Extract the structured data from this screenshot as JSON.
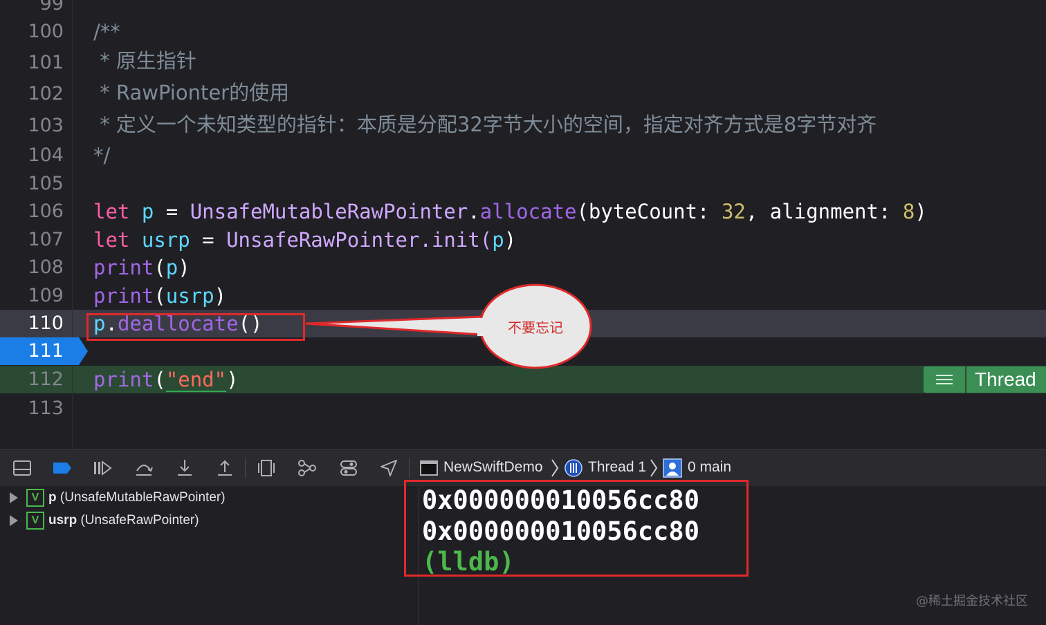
{
  "editor": {
    "lines": [
      {
        "num": "99"
      },
      {
        "num": "100",
        "text": "/**"
      },
      {
        "num": "101",
        "text": " * 原生指针"
      },
      {
        "num": "102",
        "text": " * RawPionter的使用"
      },
      {
        "num": "103",
        "text": " * 定义一个未知类型的指针：本质是分配32字节大小的空间，指定对齐方式是8字节对齐"
      },
      {
        "num": "104",
        "text": "*/"
      },
      {
        "num": "105"
      },
      {
        "num": "106"
      },
      {
        "num": "107"
      },
      {
        "num": "108"
      },
      {
        "num": "109"
      },
      {
        "num": "110"
      },
      {
        "num": "111"
      },
      {
        "num": "112"
      },
      {
        "num": "113"
      }
    ],
    "code": {
      "l106": {
        "kw": "let",
        "var": "p",
        "eq": " = ",
        "type": "UnsafeMutableRawPointer",
        "dot": ".",
        "func": "allocate",
        "args1": "(byteCount: ",
        "n1": "32",
        "args2": ", alignment: ",
        "n2": "8",
        "close": ")"
      },
      "l107": {
        "kw": "let",
        "var": "usrp",
        "eq": " = ",
        "type": "UnsafeRawPointer",
        "dot": ".init(",
        "arg": "p",
        "close": ")"
      },
      "l108": {
        "func": "print",
        "open": "(",
        "arg": "p",
        "close": ")"
      },
      "l109": {
        "func": "print",
        "open": "(",
        "arg": "usrp",
        "close": ")"
      },
      "l110": {
        "var": "p",
        "dot": ".",
        "func": "deallocate",
        "parens": "()"
      },
      "l112": {
        "func": "print",
        "open": "(",
        "str": "\"end\"",
        "close": ")"
      }
    },
    "thread_badge": "Thread",
    "callout": "不要忘记"
  },
  "toolbar": {
    "breadcrumb": {
      "project": "NewSwiftDemo",
      "thread": "Thread 1",
      "frame": "0 main"
    },
    "icons": [
      "hide-debug-area-icon",
      "breakpoints-toggle-icon",
      "continue-icon",
      "step-over-icon",
      "step-into-icon",
      "step-out-icon",
      "view-hierarchy-icon",
      "memory-graph-icon",
      "environment-overrides-icon",
      "simulate-location-icon"
    ]
  },
  "variables": [
    {
      "name": "p",
      "type": "(UnsafeMutableRawPointer)"
    },
    {
      "name": "usrp",
      "type": "(UnsafeRawPointer)"
    }
  ],
  "console": {
    "lines": [
      "0x000000010056cc80",
      "0x000000010056cc80"
    ],
    "prompt": "(lldb)"
  },
  "watermark": "@稀土掘金技术社区",
  "colors": {
    "keyword": "#fc5fa3",
    "variable": "#5dd8ff",
    "type": "#d0a8ff",
    "function": "#a167e6",
    "number": "#d0bf69",
    "string": "#fc6a5d",
    "current_line": "#1a7ee6",
    "exec_line": "#2a4a33",
    "annotation": "#e0292a"
  }
}
